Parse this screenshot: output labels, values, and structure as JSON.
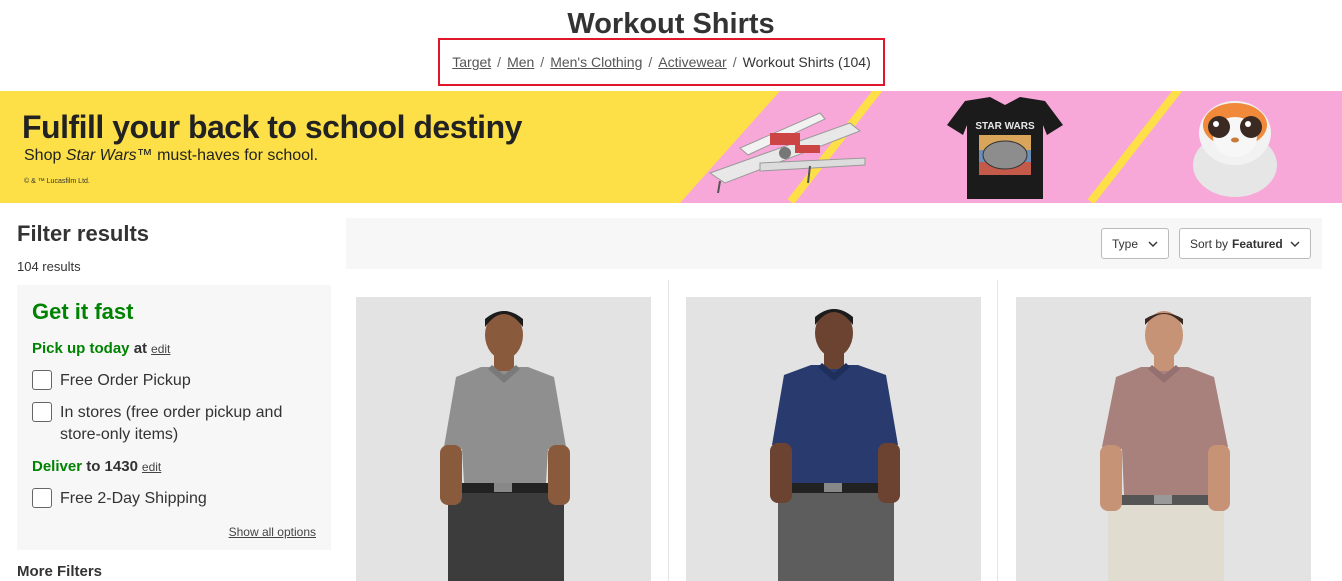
{
  "header": {
    "title": "Workout Shirts"
  },
  "breadcrumb": {
    "items": [
      "Target",
      "Men",
      "Men's Clothing",
      "Activewear"
    ],
    "separator": "/",
    "current": "Workout Shirts (104)"
  },
  "banner": {
    "headline": "Fulfill your back to school destiny",
    "sub_prefix": "Shop ",
    "sub_italic": "Star Wars",
    "sub_suffix": "™ must-haves for school.",
    "legal": "© & ™ Lucasfilm Ltd.",
    "tshirt_text": "STAR WARS",
    "colors": {
      "yellow": "#fde047",
      "pink": "#f8a8d8"
    }
  },
  "sidebar": {
    "title": "Filter results",
    "results_count": "104 results",
    "get_it_fast": {
      "title": "Get it fast",
      "pickup_label": "Pick up today",
      "pickup_at": " at",
      "edit": "edit",
      "options_pickup": [
        "Free Order Pickup",
        "In stores (free order pickup and store-only items)"
      ],
      "deliver_label": "Deliver",
      "deliver_to": " to 1430",
      "options_deliver": [
        "Free 2-Day Shipping"
      ],
      "show_all": "Show all options"
    },
    "more_filters": "More Filters"
  },
  "toolbar": {
    "type_label": "Type",
    "sort_prefix": "Sort by",
    "sort_value": "Featured"
  },
  "products": [
    {
      "shirt_color": "#8f8f8f",
      "pants_color": "#3c3c3c"
    },
    {
      "shirt_color": "#283a6e",
      "pants_color": "#5d5d5d"
    },
    {
      "shirt_color": "#a8807c",
      "pants_color": "#e0dccf"
    }
  ],
  "colors": {
    "accent_green": "#008300",
    "highlight_red": "#e0162b"
  }
}
